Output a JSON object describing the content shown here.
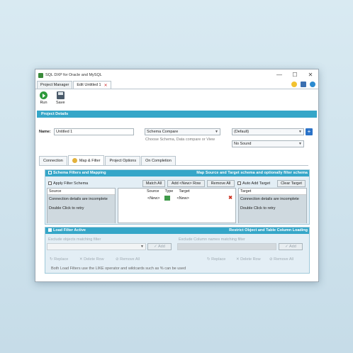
{
  "window": {
    "title": "SQL DXP for Oracle and MySQL",
    "controls": {
      "minimize": "—",
      "maximize": "☐",
      "close": "✕"
    }
  },
  "doc_tabs": [
    {
      "label": "Project Manager"
    },
    {
      "label": "Edit Untitled 1",
      "close": "✕"
    }
  ],
  "toolbar": {
    "run_label": "Run",
    "save_label": "Save"
  },
  "project_details": {
    "header": "Project Details",
    "name_label": "Name:",
    "name_value": "Untitled 1",
    "schema_compare_value": "Schema Compare",
    "schema_hint": "Choose Schema, Data compare or View",
    "default_value": "(Default)",
    "sound_value": "No Sound",
    "plus": "+"
  },
  "section_tabs": [
    {
      "label": "Connection"
    },
    {
      "label": "Map & Filter"
    },
    {
      "label": "Project Options"
    },
    {
      "label": "On Completion"
    }
  ],
  "schema_filters": {
    "header_left": "Schema Filters and Mapping",
    "header_right": "Map Source and Target schema and optionally filter schema",
    "apply_filter": "Apply Filter Schema",
    "match_all": "Match All",
    "add_new_row": "Add <New> Row",
    "remove_all": "Remove All",
    "auto_add_target": "Auto Add Target",
    "clear_target": "Clear Target",
    "source_col": "Source",
    "source_msg": "Connection details are incomplete",
    "source_retry": "Double Click to retry",
    "map_cols": {
      "source": "Source",
      "type": "Type",
      "target": "Target"
    },
    "map_row": {
      "source": "<New>",
      "target": "<New>"
    },
    "target_col": "Target",
    "target_msg": "Connection details are incomplete",
    "target_retry": "Double Click to retry"
  },
  "load_filter": {
    "header_left": "Load Filter Active",
    "header_right": "Restrict Object and Table Column Loading",
    "exclude_objects": "Exclude objects matching filter",
    "exclude_columns": "Exclude Column names matching filter",
    "add": "Add",
    "replace": "Replace",
    "delete_row": "Delete Row",
    "remove_all": "Remove All",
    "note": "Both Load Filters use the LIKE operator and wildcards such as % can be used"
  },
  "colors": {
    "accent": "#35a6c8",
    "panel": "#e3eef5",
    "run": "#2e9a3a",
    "delete": "#cc3322"
  }
}
